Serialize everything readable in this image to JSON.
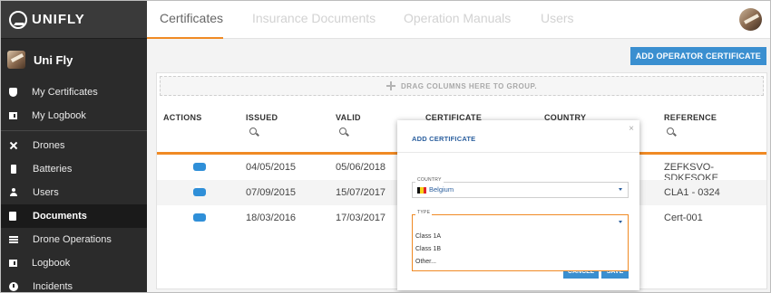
{
  "app": {
    "brand": "UNIFLY"
  },
  "sidebar": {
    "user_name": "Uni Fly",
    "items": [
      {
        "label": "My Certificates",
        "icon": "shield-icon"
      },
      {
        "label": "My Logbook",
        "icon": "book-icon"
      },
      {
        "label": "Drones",
        "icon": "drone-icon"
      },
      {
        "label": "Batteries",
        "icon": "battery-icon"
      },
      {
        "label": "Users",
        "icon": "user-icon"
      },
      {
        "label": "Documents",
        "icon": "document-icon",
        "active": true
      },
      {
        "label": "Drone Operations",
        "icon": "list-icon"
      },
      {
        "label": "Logbook",
        "icon": "book-icon"
      },
      {
        "label": "Incidents",
        "icon": "alert-icon"
      }
    ]
  },
  "header": {
    "tabs": [
      {
        "label": "Certificates",
        "active": true
      },
      {
        "label": "Insurance Documents"
      },
      {
        "label": "Operation Manuals"
      },
      {
        "label": "Users"
      }
    ]
  },
  "toolbar": {
    "add_label": "ADD OPERATOR CERTIFICATE"
  },
  "grid": {
    "group_hint": "DRAG COLUMNS HERE TO GROUP.",
    "columns": [
      "ACTIONS",
      "ISSUED",
      "VALID",
      "CERTIFICATE",
      "COUNTRY",
      "REFERENCE"
    ],
    "rows": [
      {
        "issued": "04/05/2015",
        "valid": "05/06/2018",
        "reference": "ZEFKSVO-SDKFSOKE"
      },
      {
        "issued": "07/09/2015",
        "valid": "15/07/2017",
        "reference": "CLA1 - 0324"
      },
      {
        "issued": "18/03/2016",
        "valid": "17/03/2017",
        "reference": "Cert-001"
      }
    ]
  },
  "modal": {
    "title": "ADD CERTIFICATE",
    "close": "×",
    "country_label": "COUNTRY",
    "country_value": "Belgium",
    "type_label": "TYPE",
    "type_options": [
      "Class 1A",
      "Class 1B",
      "Other..."
    ],
    "cancel_label": "CANCEL",
    "save_label": "SAVE"
  },
  "colors": {
    "accent": "#f08a24",
    "primary": "#3a8fd0",
    "sidebar": "#2b2b2b",
    "link": "#2b5f9e"
  }
}
